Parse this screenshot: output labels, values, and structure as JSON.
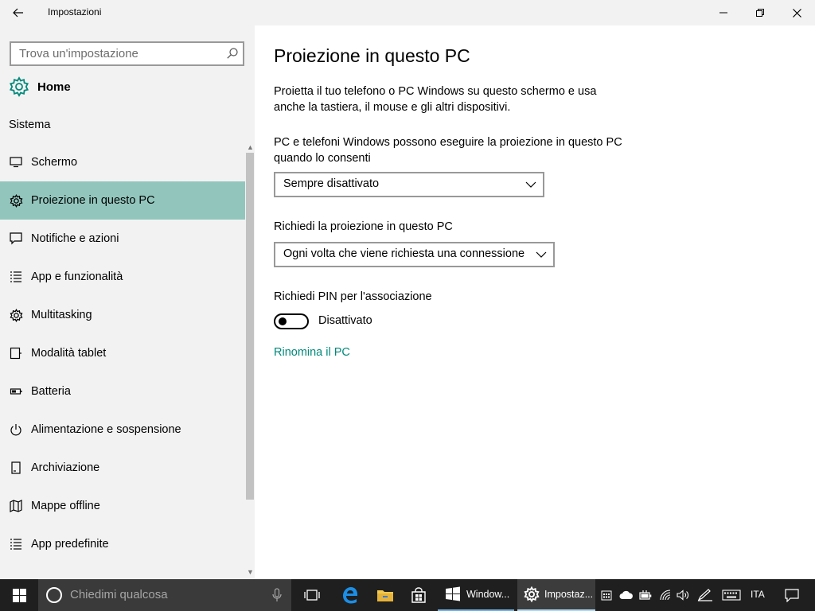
{
  "window": {
    "title": "Impostazioni",
    "back_icon": "back-arrow-icon",
    "minimize_icon": "minimize-icon",
    "restore_icon": "restore-icon",
    "close_icon": "close-icon"
  },
  "sidebar": {
    "search_placeholder": "Trova un'impostazione",
    "home_label": "Home",
    "section_title": "Sistema",
    "items": [
      {
        "label": "Schermo",
        "icon": "monitor-icon",
        "active": false
      },
      {
        "label": "Proiezione in questo PC",
        "icon": "gear-icon",
        "active": true
      },
      {
        "label": "Notifiche e azioni",
        "icon": "chat-bubble-icon",
        "active": false
      },
      {
        "label": "App e funzionalità",
        "icon": "list-icon",
        "active": false
      },
      {
        "label": "Multitasking",
        "icon": "gear-icon",
        "active": false
      },
      {
        "label": "Modalità tablet",
        "icon": "tablet-icon",
        "active": false
      },
      {
        "label": "Batteria",
        "icon": "battery-icon",
        "active": false
      },
      {
        "label": "Alimentazione e sospensione",
        "icon": "power-icon",
        "active": false
      },
      {
        "label": "Archiviazione",
        "icon": "storage-icon",
        "active": false
      },
      {
        "label": "Mappe offline",
        "icon": "map-icon",
        "active": false
      },
      {
        "label": "App predefinite",
        "icon": "list-icon",
        "active": false
      }
    ]
  },
  "main": {
    "title": "Proiezione in questo PC",
    "description": "Proietta il tuo telefono o PC Windows su questo schermo e usa anche la tastiera, il mouse e gli altri dispositivi.",
    "projection_label": "PC e telefoni Windows possono eseguire la proiezione in questo PC quando lo consenti",
    "projection_value": "Sempre disattivato",
    "request_label": "Richiedi la proiezione in questo PC",
    "request_value": "Ogni volta che viene richiesta una connessione",
    "pin_label": "Richiedi PIN per l'associazione",
    "pin_toggle_state": "Disattivato",
    "rename_link": "Rinomina il PC"
  },
  "taskbar": {
    "search_placeholder": "Chiedimi qualcosa",
    "apps": [
      {
        "label": "Window...",
        "icon": "window-icon"
      },
      {
        "label": "Impostaz...",
        "icon": "gear-icon",
        "active": true
      }
    ],
    "language": "ITA"
  }
}
